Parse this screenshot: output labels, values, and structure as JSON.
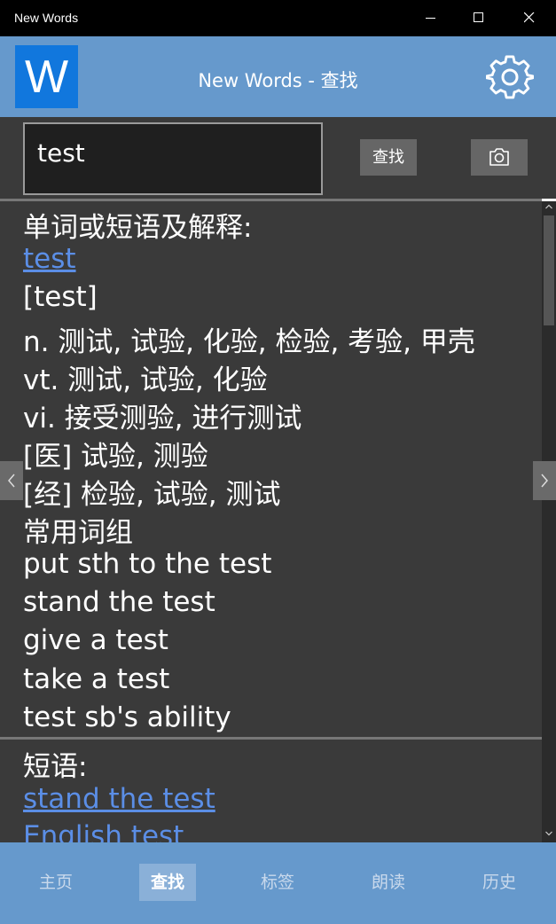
{
  "window": {
    "title": "New Words"
  },
  "appbar": {
    "logo_letter": "W",
    "title": "New Words - 查找"
  },
  "search": {
    "value": "test",
    "button_label": "查找"
  },
  "entry": {
    "heading": "单词或短语及解释:",
    "word": "test",
    "phonetic": "[test]",
    "definitions": [
      "n.  测试, 试验, 化验, 检验, 考验, 甲壳",
      "vt.  测试, 试验, 化验",
      "vi.  接受测验, 进行测试",
      "[医] 试验, 测验",
      "[经] 检验, 试验, 测试"
    ],
    "phrases_heading": "常用词组",
    "common_phrases": [
      "put sth to the test",
      "stand the test",
      "give a test",
      "take a test",
      "test sb's ability"
    ]
  },
  "related": {
    "heading": "短语:",
    "links": [
      "stand the test",
      "English test"
    ]
  },
  "nav": {
    "items": [
      {
        "label": "主页"
      },
      {
        "label": "查找"
      },
      {
        "label": "标签"
      },
      {
        "label": "朗读"
      },
      {
        "label": "历史"
      }
    ],
    "active_index": 1
  },
  "colors": {
    "accent": "#6699cc",
    "logo": "#1177dd",
    "content_bg": "#3a3a3a",
    "link": "#5b8ee6"
  },
  "icons": [
    "minimize-icon",
    "maximize-icon",
    "close-icon",
    "settings-gear-icon",
    "camera-icon",
    "chevron-left-icon",
    "chevron-right-icon",
    "scroll-up-icon",
    "scroll-down-icon"
  ]
}
